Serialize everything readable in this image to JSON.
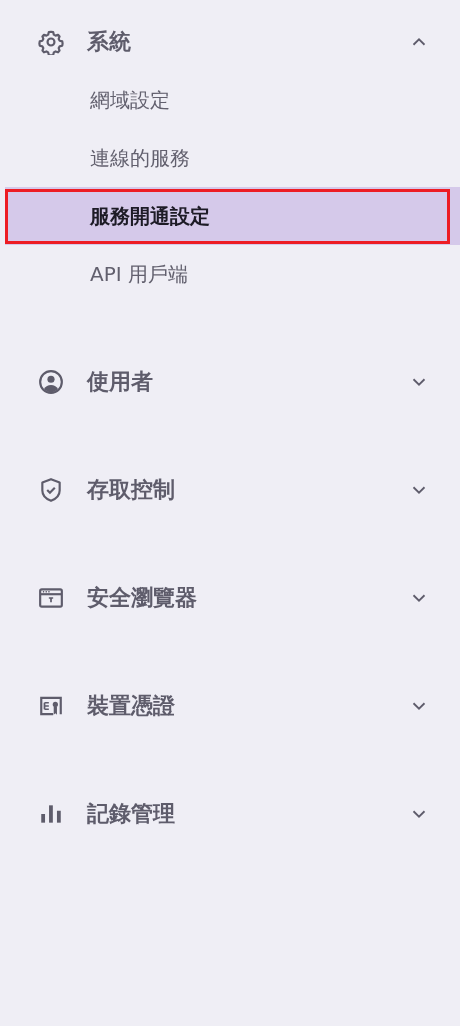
{
  "sidebar": {
    "sections": [
      {
        "label": "系統",
        "expanded": true,
        "children": [
          {
            "label": "網域設定",
            "selected": false,
            "highlighted": false
          },
          {
            "label": "連線的服務",
            "selected": false,
            "highlighted": false
          },
          {
            "label": "服務開通設定",
            "selected": true,
            "highlighted": true
          },
          {
            "label": "API 用戶端",
            "selected": false,
            "highlighted": false
          }
        ]
      },
      {
        "label": "使用者",
        "expanded": false
      },
      {
        "label": "存取控制",
        "expanded": false
      },
      {
        "label": "安全瀏覽器",
        "expanded": false
      },
      {
        "label": "裝置憑證",
        "expanded": false
      },
      {
        "label": "記錄管理",
        "expanded": false
      }
    ]
  }
}
